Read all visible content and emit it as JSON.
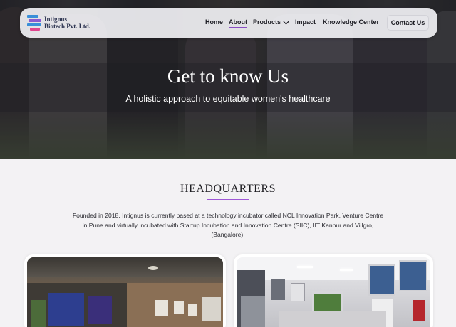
{
  "logo": {
    "line1": "Intignus",
    "line2": "Biotech Pvt. Ltd."
  },
  "nav": {
    "items": [
      "Home",
      "About",
      "Products",
      "Impact",
      "Knowledge Center"
    ],
    "active": "About",
    "cta": "Contact Us"
  },
  "hero": {
    "title": "Get to know Us",
    "subtitle": "A holistic approach to equitable women's healthcare"
  },
  "headquarters": {
    "title": "HEADQUARTERS",
    "body": "Founded in 2018, Intignus is currently based at a technology incubator called NCL Innovation Park, Venture Centre in Pune and virtually incubated with Startup Incubation and Innovation Centre (SIIC), IIT Kanpur and Villgro, (Bangalore)."
  },
  "colors": {
    "accent": "#9e57d6",
    "logo_blue": "#3a8fd8",
    "logo_pink": "#e0458e"
  }
}
